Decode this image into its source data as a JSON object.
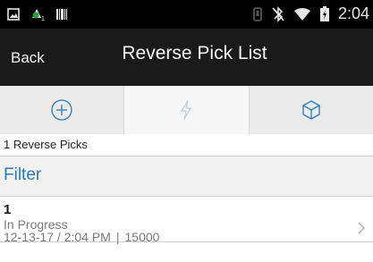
{
  "statusbar": {
    "time": "2:04",
    "icons": [
      "image-icon",
      "app-notification-icon",
      "barcode-icon",
      "vibrate-icon",
      "bluetooth-off-icon",
      "wifi-icon",
      "battery-icon"
    ]
  },
  "header": {
    "back_label": "Back",
    "title": "Reverse Pick List"
  },
  "toolbar": {
    "buttons": [
      {
        "icon": "add-icon",
        "active": false
      },
      {
        "icon": "lightning-icon",
        "active": true
      },
      {
        "icon": "package-icon",
        "active": false
      }
    ]
  },
  "summary": {
    "text": "1 Reverse Picks"
  },
  "filter": {
    "label": "Filter"
  },
  "list": {
    "items": [
      {
        "id": "1",
        "status": "In Progress",
        "date_time": "12-13-17 / 2:04 PM",
        "separator": "|",
        "quantity": "15000"
      }
    ]
  },
  "colors": {
    "accent": "#2b7bbf",
    "header_bg": "#1a1a1a",
    "statusbar_bg": "#000000",
    "toolbar_bg": "#ebebeb"
  }
}
